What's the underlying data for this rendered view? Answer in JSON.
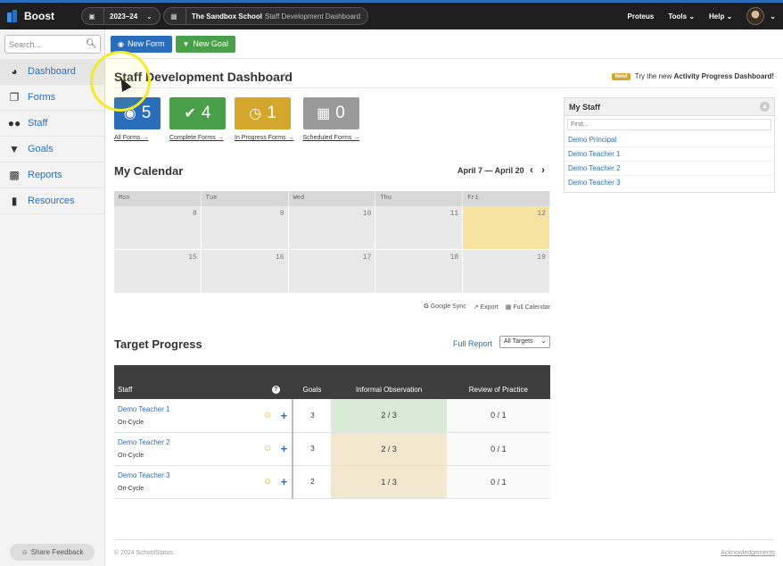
{
  "app": {
    "name": "Boost"
  },
  "topbar": {
    "year": "2023–24",
    "school_name": "The Sandbox School",
    "school_context": "Staff Development Dashboard",
    "nav": [
      "Proteus",
      "Tools",
      "Help"
    ]
  },
  "sidebar": {
    "search_placeholder": "Search...",
    "items": [
      {
        "label": "Dashboard",
        "icon": "dashboard-icon"
      },
      {
        "label": "Forms",
        "icon": "forms-icon"
      },
      {
        "label": "Staff",
        "icon": "staff-icon"
      },
      {
        "label": "Goals",
        "icon": "trophy-icon"
      },
      {
        "label": "Reports",
        "icon": "reports-icon"
      },
      {
        "label": "Resources",
        "icon": "book-icon"
      }
    ],
    "feedback": "Share Feedback"
  },
  "actions": {
    "new_form": "New Form",
    "new_goal": "New Goal"
  },
  "page": {
    "title": "Staff Development Dashboard",
    "promo_badge": "New!",
    "promo_text": "Try the new",
    "promo_link": "Activity Progress Dashboard!"
  },
  "tiles": [
    {
      "count": "5",
      "label": "All Forms →",
      "color": "#2a6ebb",
      "icon": "eye-icon"
    },
    {
      "count": "4",
      "label": "Complete Forms →",
      "color": "#4aa04a",
      "icon": "check-icon"
    },
    {
      "count": "1",
      "label": "In Progress Forms →",
      "color": "#d4a72c",
      "icon": "clock-icon"
    },
    {
      "count": "0",
      "label": "Scheduled Forms →",
      "color": "#9a9a9a",
      "icon": "calendar-icon"
    }
  ],
  "calendar": {
    "title": "My Calendar",
    "range": "April 7 — April 20",
    "days": [
      "Mon",
      "Tue",
      "Wed",
      "Thu",
      "Fri"
    ],
    "week1": [
      "8",
      "9",
      "10",
      "11",
      "12"
    ],
    "week2": [
      "15",
      "16",
      "17",
      "18",
      "19"
    ],
    "links": [
      "Google Sync",
      "Export",
      "Full Calendar"
    ]
  },
  "target_progress": {
    "title": "Target Progress",
    "full_report": "Full Report",
    "filter": "All Targets",
    "headers": [
      "Staff",
      "?",
      "Goals",
      "Informal Observation",
      "Review of Practice"
    ],
    "rows": [
      {
        "name": "Demo Teacher 1",
        "cycle": "On-Cycle",
        "goals": "3",
        "informal": "2 / 3",
        "review": "0 / 1"
      },
      {
        "name": "Demo Teacher 2",
        "cycle": "On-Cycle",
        "goals": "3",
        "informal": "2 / 3",
        "review": "0 / 1"
      },
      {
        "name": "Demo Teacher 3",
        "cycle": "On-Cycle",
        "goals": "2",
        "informal": "1 / 3",
        "review": "0 / 1"
      }
    ]
  },
  "my_staff": {
    "title": "My Staff",
    "find_placeholder": "Find...",
    "people": [
      "Demo Principal",
      "Demo Teacher 1",
      "Demo Teacher 2",
      "Demo Teacher 3"
    ]
  },
  "footer": {
    "copyright": "© 2024 SchoolStatus.",
    "link": "Acknowledgements"
  }
}
